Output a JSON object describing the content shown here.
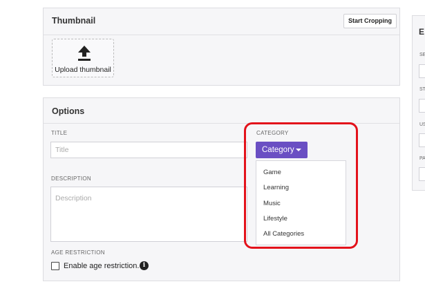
{
  "thumbnail": {
    "title": "Thumbnail",
    "start_cropping_label": "Start Cropping",
    "upload_label": "Upload thumbnail"
  },
  "options": {
    "title": "Options",
    "title_field": {
      "label": "TITLE",
      "placeholder": "Title",
      "value": ""
    },
    "description_field": {
      "label": "DESCRIPTION",
      "placeholder": "Description",
      "value": ""
    },
    "category": {
      "label": "CATEGORY",
      "button_label": "Category",
      "options": [
        "Game",
        "Learning",
        "Music",
        "Lifestyle",
        "All Categories"
      ]
    },
    "age_restriction": {
      "label": "AGE RESTRICTION",
      "checkbox_label": "Enable age restriction.",
      "checked": false
    }
  },
  "right_panel": {
    "title_partial": "E",
    "labels": [
      "SE",
      "ST",
      "US",
      "PA"
    ]
  },
  "colors": {
    "category_button": "#6a4fc3",
    "highlight": "#e3121b"
  }
}
